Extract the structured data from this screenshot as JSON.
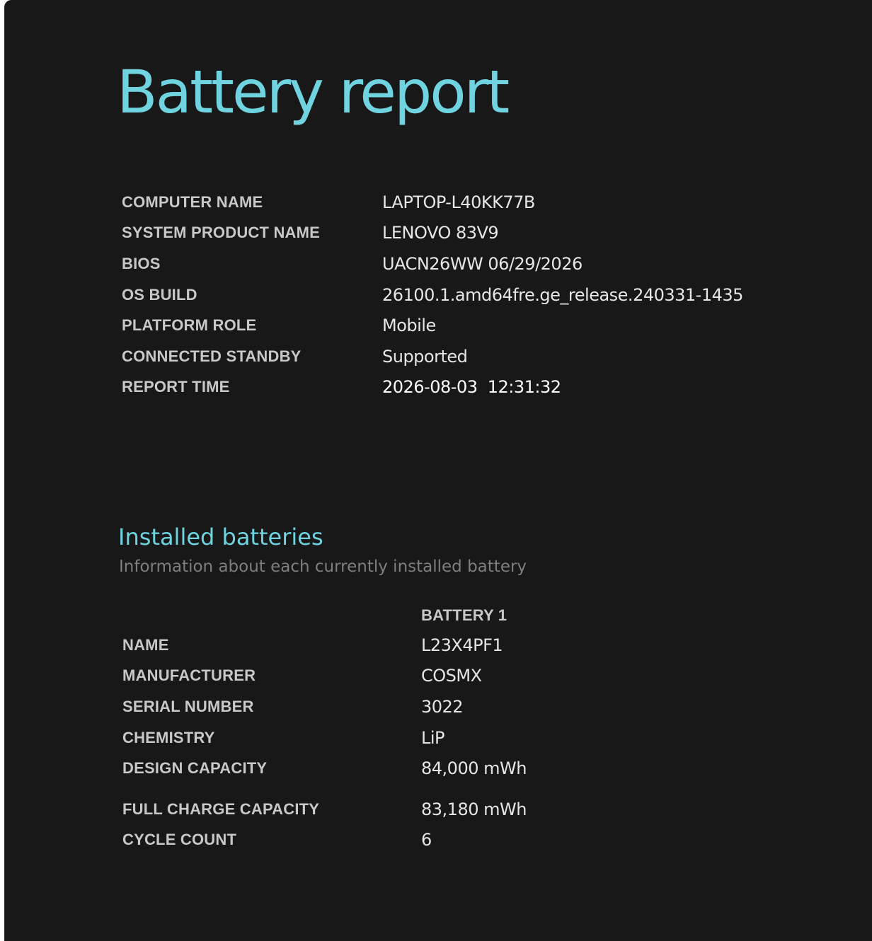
{
  "page": {
    "title": "Battery report"
  },
  "colors": {
    "background": "#181818",
    "accent": "#6fd3e0",
    "label": "#c8c8c8",
    "value": "#e6e6e6",
    "subtitle": "#7e7e7e"
  },
  "system_info": {
    "rows": [
      {
        "label": "COMPUTER NAME",
        "value": "LAPTOP-L40KK77B"
      },
      {
        "label": "SYSTEM PRODUCT NAME",
        "value": "LENOVO 83V9"
      },
      {
        "label": "BIOS",
        "value": "UACN26WW 06/29/2026"
      },
      {
        "label": "OS BUILD",
        "value": "26100.1.amd64fre.ge_release.240331-1435"
      },
      {
        "label": "PLATFORM ROLE",
        "value": "Mobile"
      },
      {
        "label": "CONNECTED STANDBY",
        "value": "Supported"
      },
      {
        "label": "REPORT TIME",
        "value": "2026-08-03  12:31:32"
      }
    ]
  },
  "installed_batteries": {
    "title": "Installed batteries",
    "subtitle": "Information about each currently installed battery",
    "column_header": "BATTERY 1",
    "rows": [
      {
        "label": "NAME",
        "value": "L23X4PF1"
      },
      {
        "label": "MANUFACTURER",
        "value": "COSMX"
      },
      {
        "label": "SERIAL NUMBER",
        "value": "3022"
      },
      {
        "label": "CHEMISTRY",
        "value": "LiP"
      },
      {
        "label": "DESIGN CAPACITY",
        "value": "84,000 mWh"
      },
      {
        "label": "FULL CHARGE CAPACITY",
        "value": "83,180 mWh"
      },
      {
        "label": "CYCLE COUNT",
        "value": "6"
      }
    ]
  }
}
